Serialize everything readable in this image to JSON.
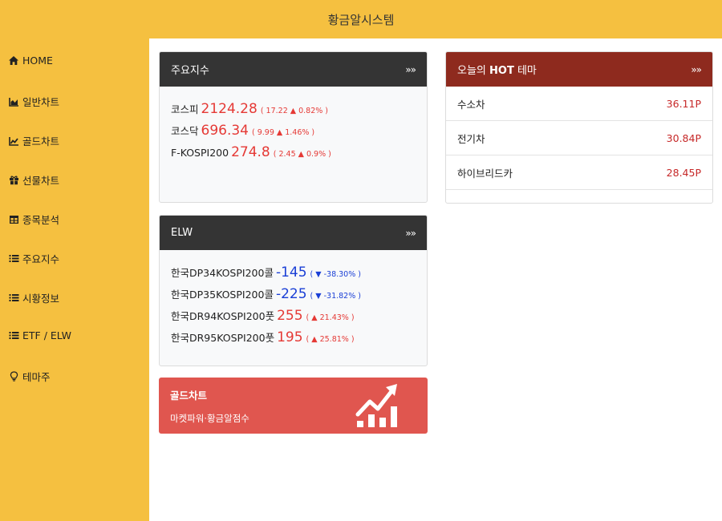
{
  "header": {
    "title": "황금알시스템"
  },
  "sidebar": {
    "items": [
      {
        "label": "HOME",
        "icon": "home-icon"
      },
      {
        "label": "일반차트",
        "icon": "area-chart-icon"
      },
      {
        "label": "골드차트",
        "icon": "line-chart-icon"
      },
      {
        "label": "선물차트",
        "icon": "gift-icon"
      },
      {
        "label": "종목분석",
        "icon": "table-icon"
      },
      {
        "label": "주요지수",
        "icon": "list-icon"
      },
      {
        "label": "시황정보",
        "icon": "list-icon"
      },
      {
        "label": "ETF / ELW",
        "icon": "list-icon"
      },
      {
        "label": "테마주",
        "icon": "lightbulb-icon"
      }
    ]
  },
  "indices": {
    "title": "주요지수",
    "more": "»»",
    "rows": [
      {
        "name": "코스피",
        "value": "2124.28",
        "change": "( 17.22 ▲ 0.82% )",
        "direction": "up"
      },
      {
        "name": "코스닥",
        "value": "696.34",
        "change": "( 9.99 ▲ 1.46% )",
        "direction": "up"
      },
      {
        "name": "F-KOSPI200",
        "value": "274.8",
        "change": "( 2.45 ▲ 0.9% )",
        "direction": "up"
      }
    ]
  },
  "elw": {
    "title": "ELW",
    "more": "»»",
    "rows": [
      {
        "name": "한국DP34KOSPI200콜",
        "value": "-145",
        "change": "( ▼ -38.30% )",
        "direction": "down"
      },
      {
        "name": "한국DP35KOSPI200콜",
        "value": "-225",
        "change": "( ▼ -31.82% )",
        "direction": "down"
      },
      {
        "name": "한국DR94KOSPI200풋",
        "value": "255",
        "change": "( ▲ 21.43% )",
        "direction": "up"
      },
      {
        "name": "한국DR95KOSPI200풋",
        "value": "195",
        "change": "( ▲ 25.81% )",
        "direction": "up"
      }
    ]
  },
  "gold_card": {
    "title": "골드차트",
    "subtitle": "마켓파워·황금알점수",
    "icon": "growth-chart-icon"
  },
  "hot_theme": {
    "title_prefix": "오늘의 ",
    "title_bold": "HOT",
    "title_suffix": " 테마",
    "more": "»»",
    "rows": [
      {
        "name": "수소차",
        "points": "36.11P"
      },
      {
        "name": "전기차",
        "points": "30.84P"
      },
      {
        "name": "하이브리드카",
        "points": "28.45P"
      }
    ]
  },
  "colors": {
    "sidebar_bg": "#f5c040",
    "panel_head": "#343434",
    "hot_head": "#8e2a1e",
    "gold_card": "#e0564f",
    "up": "#e53935",
    "down": "#1a3fd6"
  }
}
